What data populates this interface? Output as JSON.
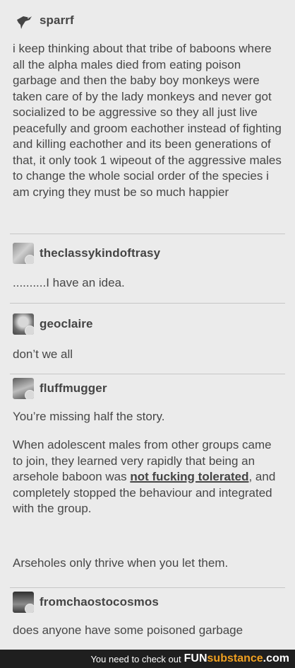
{
  "posts": [
    {
      "username": "sparrf",
      "avatar_icon": "bird-icon",
      "body": "i keep thinking about that tribe of baboons where all the alpha males died from eating poison garbage and then the baby boy monkeys were taken care of by the lady monkeys and never got socialized to be aggressive so they all just live peacefully and groom eachother instead of fighting and killing eachother and its been generations of that, it only took 1 wipeout of the aggressive males to change the whole social order of the species i am crying they must be so much happier"
    },
    {
      "username": "theclassykindoftrasy",
      "avatar_icon": "avatar-icon",
      "body": "..........I have an idea."
    },
    {
      "username": "geoclaire",
      "avatar_icon": "avatar-icon",
      "body": "don’t we all"
    },
    {
      "username": "fluffmugger",
      "avatar_icon": "avatar-icon",
      "body_p1": "You’re missing half the story.",
      "body_p2_a": "When adolescent males from other groups came to join, they learned very rapidly that being an arsehole baboon was ",
      "body_p2_emph": "not fucking tolerated",
      "body_p2_b": ", and completely stopped the behaviour and integrated with the group.",
      "body_p3": "Arseholes only thrive when you let them."
    },
    {
      "username": "fromchaostocosmos",
      "avatar_icon": "avatar-icon",
      "body": "does anyone have some poisoned garbage"
    }
  ],
  "footer": {
    "text": "You need to check out",
    "brand_fun": "FUN",
    "brand_sub": "substance",
    "brand_rest": ".com"
  }
}
